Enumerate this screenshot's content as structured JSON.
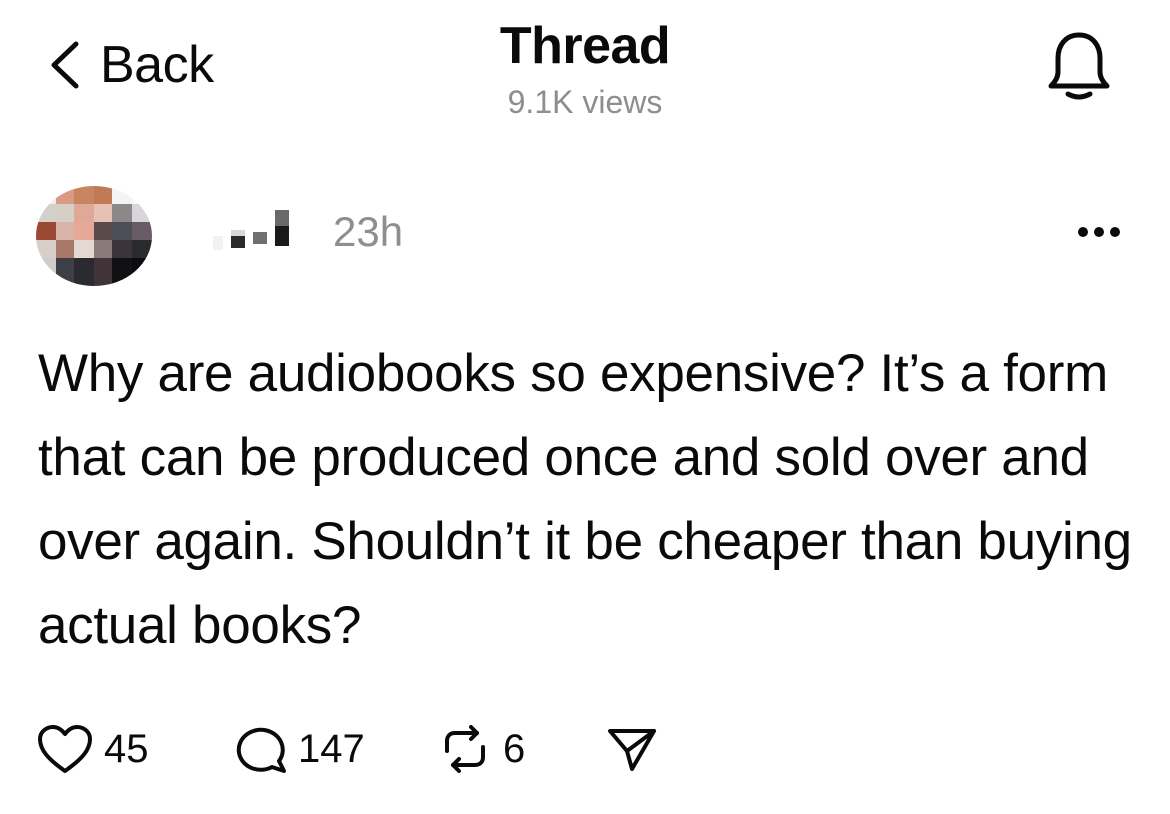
{
  "header": {
    "back_label": "Back",
    "title": "Thread",
    "views": "9.1K views",
    "bell_icon": "bell-icon"
  },
  "post": {
    "time": "23h",
    "more_icon": "more-icon",
    "text": "Why are audiobooks so expensive? It’s a form that can be produced once and sold over and over again. Shouldn’t it be cheaper than buying actual books?",
    "actions": {
      "likes": "45",
      "replies": "147",
      "reposts": "6"
    }
  },
  "colors": {
    "text": "#0a0a0a",
    "muted": "#8e8e8e",
    "background": "#ffffff"
  }
}
